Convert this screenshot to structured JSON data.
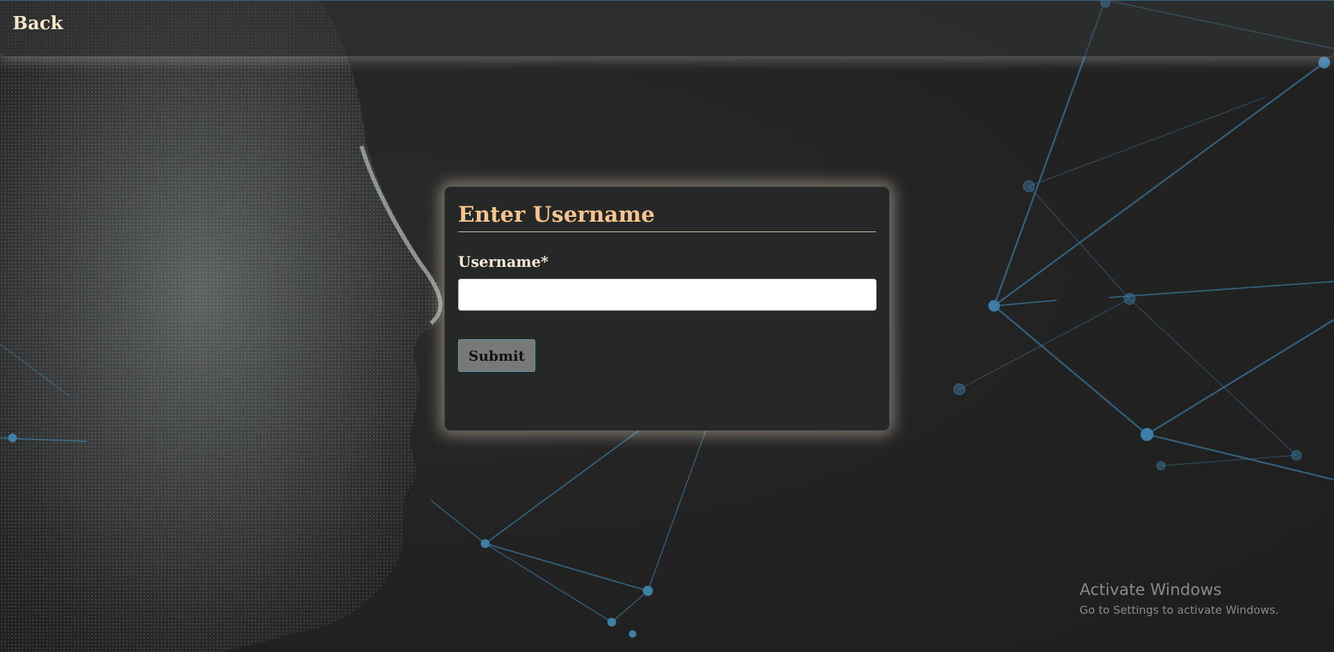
{
  "nav": {
    "back_label": "Back"
  },
  "form": {
    "title": "Enter Username",
    "username_label": "Username*",
    "username_value": "",
    "username_placeholder": "",
    "submit_label": "Submit"
  },
  "watermark": {
    "title": "Activate Windows",
    "subtitle": "Go to Settings to activate Windows."
  },
  "colors": {
    "accent_title": "#f6c48c",
    "label_text": "#f5ead7",
    "background": "#232323",
    "network_lines": "#3e7fa8"
  }
}
